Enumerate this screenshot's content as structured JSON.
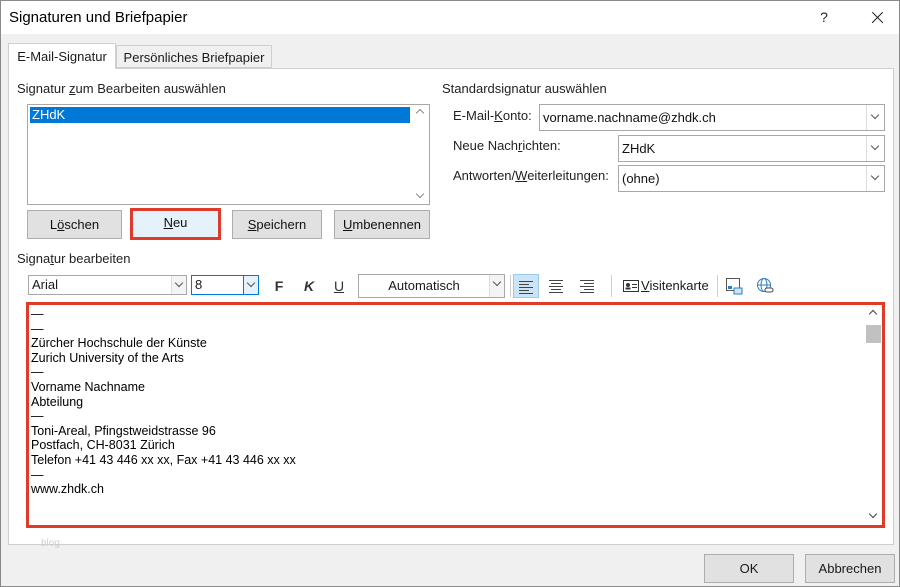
{
  "window": {
    "title": "Signaturen und Briefpapier",
    "help_label": "?"
  },
  "tabs": [
    {
      "label_underlined": "E",
      "label_rest": "-Mail-Signatur"
    },
    {
      "label_underlined": "P",
      "label_rest": "ersönliches Briefpapier"
    }
  ],
  "select_section": {
    "label_pre": "Signatur ",
    "label_underlined": "z",
    "label_post": "um Bearbeiten auswählen",
    "items": [
      "ZHdK"
    ],
    "selected": "ZHdK"
  },
  "buttons": {
    "delete": {
      "pre": "L",
      "underlined": "ö",
      "post": "schen"
    },
    "new": {
      "pre": "",
      "underlined": "N",
      "post": "eu"
    },
    "save": {
      "pre": "",
      "underlined": "S",
      "post": "peichern"
    },
    "rename": {
      "pre": "",
      "underlined": "U",
      "post": "mbenennen"
    }
  },
  "default_section": {
    "label": "Standardsignatur auswählen",
    "account_label_pre": "E-Mail-",
    "account_label_underlined": "K",
    "account_label_post": "onto:",
    "account_value": "vorname.nachname@zhdk.ch",
    "new_messages_label_pre": "Neue Nach",
    "new_messages_label_underlined": "r",
    "new_messages_label_post": "ichten:",
    "new_messages_value": "ZHdK",
    "replies_label_pre": "Antworten/",
    "replies_label_underlined": "W",
    "replies_label_post": "eiterleitungen:",
    "replies_value": "(ohne)"
  },
  "edit_section": {
    "label_pre": "Signa",
    "label_underlined": "t",
    "label_post": "ur bearbeiten"
  },
  "toolbar": {
    "font": "Arial",
    "size": "8",
    "bold": "F",
    "italic": "K",
    "underline": "U",
    "color": "Automatisch",
    "business_card_pre": "",
    "business_card_underlined": "V",
    "business_card_post": "isitenkarte"
  },
  "editor": {
    "lines": [
      "—",
      "—",
      "Zürcher Hochschule der Künste",
      "Zurich University of the Arts",
      "—",
      "Vorname Nachname",
      "Abteilung",
      "—",
      "Toni-Areal, Pfingstweidstrasse 96",
      "Postfach, CH-8031 Zürich",
      "Telefon +41 43 446 xx xx, Fax +41 43 446 xx xx",
      "—",
      "www.zhdk.ch"
    ]
  },
  "watermark": "blog",
  "footer": {
    "ok": "OK",
    "cancel": "Abbrechen"
  },
  "colors": {
    "highlight_border": "#e03a2a",
    "selection": "#0078d7"
  }
}
